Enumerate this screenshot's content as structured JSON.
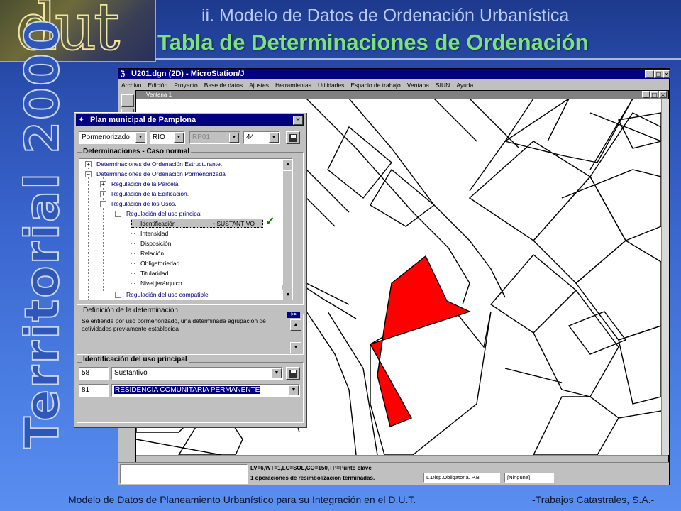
{
  "slide": {
    "logo_text": "dut",
    "title_line1": "ii. Modelo de Datos de Ordenación Urbanística",
    "title_line2": "Tabla de Determinaciones de Ordenación",
    "vertical_text": "Territorial 2000",
    "footer_left": "Modelo de Datos de Planeamiento Urbanístico para su Integración en el D.U.T.",
    "footer_right": "-Trabajos Catastrales, S.A.-"
  },
  "microstation": {
    "title": "U201.dgn (2D) - MicroStation/J",
    "menu": [
      "Archivo",
      "Edición",
      "Proyecto",
      "Base de datos",
      "Ajustes",
      "Herramientas",
      "Utilidades",
      "Espacio de trabajo",
      "Ventana",
      "SIUN",
      "Ayuda"
    ],
    "view_title": "Ventana 1",
    "status_line1": "LV=6,WT=1,LC=SOL,CO=150,TP=Punto clave",
    "status_line2": "1 operaciones de resimbolización terminadas.",
    "level_box": "L.Disp.Obligatoria. P.B",
    "none_box": "[Ninguna]",
    "highlight_color": "#ff0000"
  },
  "dialog": {
    "title": "Plan municipal de Pamplona",
    "combos": {
      "plan": "Pormenorizado",
      "zone": "RIO",
      "code": "RP01",
      "number": "44"
    },
    "group1_label": "Determinaciones - Caso normal",
    "tree": {
      "l1a": "Determinaciones de Ordenación Estructurante.",
      "l1b": "Determinaciones de Ordenación Pormenorizada",
      "l2a": "Regulación de la Parcela.",
      "l2b": "Regulación de la Edificación.",
      "l2c": "Regulación de los Usos.",
      "l3a": "Regulación del uso principal",
      "leaf_sel": "Identificación",
      "leaf_sel_value": "• SUSTANTIVO",
      "leaf2": "Intensidad",
      "leaf3": "Disposición",
      "leaf4": "Relación",
      "leaf5": "Obligatoriedad",
      "leaf6": "Titularidad",
      "leaf7": "Nivel jerárquico",
      "l3b": "Regulación del uso compatible"
    },
    "group2_label": "Definición de la determinación",
    "definition": "Se entiende por uso pormenorizado, una determinada agrupación de actividades previamente establecida",
    "expand_label": ">>",
    "group3_label": "Identificación del uso principal",
    "row1_code": "58",
    "row1_value": "Sustantivo",
    "row2_code": "81",
    "row2_value": "RESIDENCIA COMUNITARIA PERMANENTE"
  }
}
